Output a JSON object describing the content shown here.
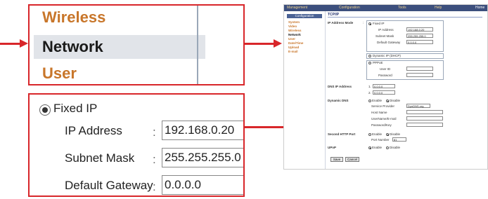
{
  "zoom_nav": {
    "items": [
      "Wireless",
      "Network",
      "User"
    ]
  },
  "zoom_ip": {
    "fixed_ip_label": "Fixed IP",
    "ip_label": "IP Address",
    "ip_value": "192.168.0.20",
    "mask_label": "Subnet Mask",
    "mask_value": "255.255.255.0",
    "gateway_label": "Default Gateway",
    "gateway_value": "0.0.0.0",
    "colon": ":"
  },
  "screen": {
    "topbar": [
      "Management",
      "Configuration",
      "Tools",
      "Help",
      "Home"
    ],
    "sidebar_title": "Configuration",
    "sidebar": [
      "System",
      "Video",
      "Wireless",
      "Network",
      "User",
      "Date/Time",
      "Upload",
      "E-mail"
    ],
    "tab_title": "TCP/IP",
    "ip_mode_label": "IP Address Mode",
    "fixed_ip": "Fixed IP",
    "ip_address_label": "IP Address",
    "ip_address_value": "192.168.0.20",
    "subnet_label": "Subnet Mask",
    "subnet_value": "255.255.255.0",
    "gateway_label": "Default Gateway",
    "gateway_value": "0.0.0.0",
    "dhcp": "Dynamic IP (DHCP)",
    "pppoe": "PPPoE",
    "user_id_label": "User ID",
    "password_label": "Password",
    "dns_label": "DNS IP Address",
    "dns1_num": "1.",
    "dns1_value": "0.0.0.0",
    "dns2_num": "2.",
    "dns2_value": "0.0.0.0",
    "ddns_label": "Dynamic DNS",
    "enable": "Enable",
    "disable": "Disable",
    "provider_label": "Service Provider",
    "provider_value": "DynDNS.org",
    "host_label": "Host Name",
    "username_label": "UserName/E-mail",
    "ddns_password_label": "Password/Key",
    "http_label": "Second HTTP Port",
    "port_label": "Port Number",
    "port_value": "81",
    "upnp_label": "UPnP",
    "save": "Save",
    "cancel": "Cancel",
    "colon": ":"
  }
}
